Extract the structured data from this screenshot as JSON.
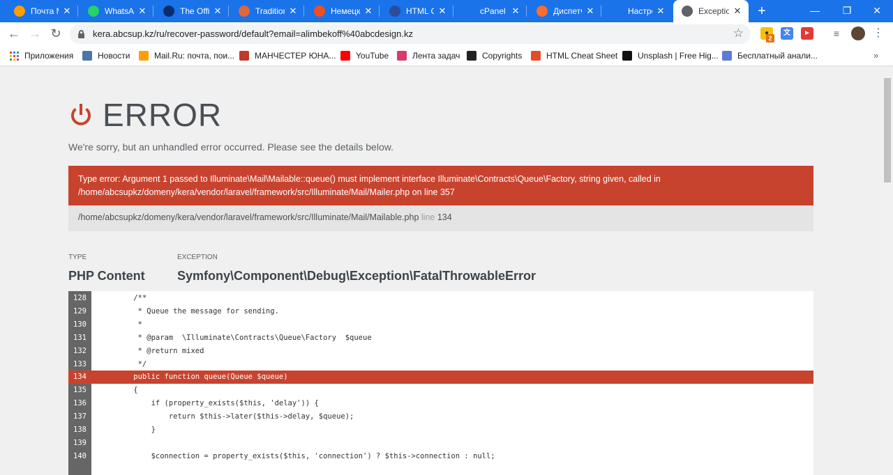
{
  "tabs": [
    {
      "title": "Почта M",
      "icon": "mail-ru-icon",
      "color": "#ff9e00"
    },
    {
      "title": "WhatsAp",
      "icon": "whatsapp-icon",
      "color": "#25d366"
    },
    {
      "title": "The Offic",
      "icon": "office-icon",
      "color": "#0b2d6b"
    },
    {
      "title": "Tradition",
      "icon": "g-icon",
      "color": "#e0673a"
    },
    {
      "title": "Немецка",
      "icon": "figma-icon",
      "color": "#f24e1e"
    },
    {
      "title": "HTML Cl",
      "icon": "html-icon",
      "color": "#2b4c9b"
    },
    {
      "title": "cPanel - I",
      "icon": "cpanel-icon",
      "color": "#1a73e8"
    },
    {
      "title": "Диспетч",
      "icon": "cpanel-orange-icon",
      "color": "#ff6c2c"
    },
    {
      "title": "Настрой",
      "icon": "settings-dot-icon",
      "color": "#1a73e8"
    },
    {
      "title": "Exception",
      "icon": "globe-icon",
      "color": "#5f6368",
      "active": true
    }
  ],
  "address": {
    "url": "kera.abcsup.kz/ru/recover-password/default?email=alimbekoff%40abcdesign.kz"
  },
  "extensions": {
    "badge": "2"
  },
  "bookmarks": [
    {
      "label": "Приложения",
      "icon": "apps-icon",
      "color": "#4285f4"
    },
    {
      "label": "Новости",
      "icon": "vk-icon",
      "color": "#4a76a8"
    },
    {
      "label": "Mail.Ru: почта, пои...",
      "icon": "mail-ru-icon",
      "color": "#ff9e00"
    },
    {
      "label": "МАНЧЕСТЕР ЮНА...",
      "icon": "mu-icon",
      "color": "#c0392b"
    },
    {
      "label": "YouTube",
      "icon": "youtube-icon",
      "color": "#ff0000"
    },
    {
      "label": "Лента задач",
      "icon": "tasks-icon",
      "color": "#d63b6b"
    },
    {
      "label": "Copyrights",
      "icon": "trello-icon",
      "color": "#222222"
    },
    {
      "label": "HTML Cheat Sheet",
      "icon": "html-cheat-icon",
      "color": "#e44d26"
    },
    {
      "label": "Unsplash | Free Hig...",
      "icon": "unsplash-icon",
      "color": "#111111"
    },
    {
      "label": "Бесплатный анали...",
      "icon": "analytics-icon",
      "color": "#5b7bd5"
    }
  ],
  "error": {
    "title": "ERROR",
    "subtitle": "We're sorry, but an unhandled error occurred. Please see the details below.",
    "message_line1": "Type error: Argument 1 passed to Illuminate\\Mail\\Mailable::queue() must implement interface Illuminate\\Contracts\\Queue\\Factory, string given, called in",
    "message_line2": "/home/abcsupkz/domeny/kera/vendor/laravel/framework/src/Illuminate/Mail/Mailer.php on line 357",
    "file_path": "/home/abcsupkz/domeny/kera/vendor/laravel/framework/src/Illuminate/Mail/Mailable.php",
    "file_line_word": "line",
    "file_line": "134",
    "accent_color": "#c8432e"
  },
  "meta": {
    "type_label": "TYPE",
    "type_value": "PHP Content",
    "exception_label": "EXCEPTION",
    "exception_value": "Symfony\\Component\\Debug\\Exception\\FatalThrowableError"
  },
  "code": [
    {
      "n": "128",
      "t": "    /**"
    },
    {
      "n": "129",
      "t": "     * Queue the message for sending."
    },
    {
      "n": "130",
      "t": "     *"
    },
    {
      "n": "131",
      "t": "     * @param  \\Illuminate\\Contracts\\Queue\\Factory  $queue"
    },
    {
      "n": "132",
      "t": "     * @return mixed"
    },
    {
      "n": "133",
      "t": "     */"
    },
    {
      "n": "134",
      "t": "    public function queue(Queue $queue)",
      "highlight": true
    },
    {
      "n": "135",
      "t": "    {"
    },
    {
      "n": "136",
      "t": "        if (property_exists($this, 'delay')) {"
    },
    {
      "n": "137",
      "t": "            return $this->later($this->delay, $queue);"
    },
    {
      "n": "138",
      "t": "        }"
    },
    {
      "n": "139",
      "t": ""
    },
    {
      "n": "140",
      "t": "        $connection = property_exists($this, 'connection') ? $this->connection : null;"
    }
  ]
}
